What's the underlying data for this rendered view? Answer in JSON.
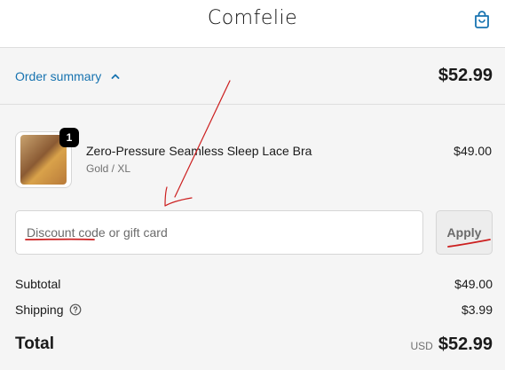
{
  "header": {
    "logo": "Comfelie",
    "cart_icon": "shopping-bag-icon"
  },
  "summary": {
    "toggle_label": "Order summary",
    "toggle_icon": "chevron-up-icon",
    "total": "$52.99"
  },
  "line_item": {
    "quantity": "1",
    "name": "Zero-Pressure Seamless Sleep Lace Bra",
    "variant": "Gold / XL",
    "price": "$49.00"
  },
  "discount": {
    "placeholder": "Discount code or gift card",
    "apply_label": "Apply"
  },
  "totals": {
    "subtotal_label": "Subtotal",
    "subtotal_value": "$49.00",
    "shipping_label": "Shipping",
    "shipping_value": "$3.99",
    "total_label": "Total",
    "currency": "USD",
    "total_value": "$52.99"
  },
  "colors": {
    "link": "#1773b0",
    "annotation": "#cc1f1f"
  }
}
